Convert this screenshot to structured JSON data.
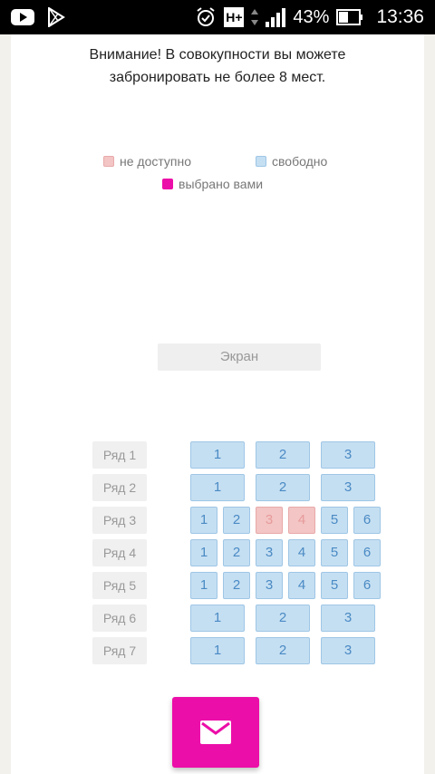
{
  "status_bar": {
    "battery_percent": "43%",
    "time": "13:36",
    "network": "H+"
  },
  "notice": {
    "line1": "Внимание! В совокупности вы можете",
    "line2": "забронировать не более 8 мест."
  },
  "legend": {
    "unavailable": "не доступно",
    "available": "свободно",
    "selected": "выбрано вами"
  },
  "colors": {
    "unavailable": "#f3c5c5",
    "available": "#c5dff2",
    "selected": "#ec0ea8"
  },
  "screen_label": "Экран",
  "rows": [
    {
      "label": "Ряд 1",
      "seats": [
        {
          "n": "1",
          "status": "available"
        },
        {
          "n": "2",
          "status": "available"
        },
        {
          "n": "3",
          "status": "available"
        }
      ]
    },
    {
      "label": "Ряд 2",
      "seats": [
        {
          "n": "1",
          "status": "available"
        },
        {
          "n": "2",
          "status": "available"
        },
        {
          "n": "3",
          "status": "available"
        }
      ]
    },
    {
      "label": "Ряд 3",
      "seats": [
        {
          "n": "1",
          "status": "available"
        },
        {
          "n": "2",
          "status": "available"
        },
        {
          "n": "3",
          "status": "unavailable"
        },
        {
          "n": "4",
          "status": "unavailable"
        },
        {
          "n": "5",
          "status": "available"
        },
        {
          "n": "6",
          "status": "available"
        }
      ]
    },
    {
      "label": "Ряд 4",
      "seats": [
        {
          "n": "1",
          "status": "available"
        },
        {
          "n": "2",
          "status": "available"
        },
        {
          "n": "3",
          "status": "available"
        },
        {
          "n": "4",
          "status": "available"
        },
        {
          "n": "5",
          "status": "available"
        },
        {
          "n": "6",
          "status": "available"
        }
      ]
    },
    {
      "label": "Ряд 5",
      "seats": [
        {
          "n": "1",
          "status": "available"
        },
        {
          "n": "2",
          "status": "available"
        },
        {
          "n": "3",
          "status": "available"
        },
        {
          "n": "4",
          "status": "available"
        },
        {
          "n": "5",
          "status": "available"
        },
        {
          "n": "6",
          "status": "available"
        }
      ]
    },
    {
      "label": "Ряд 6",
      "seats": [
        {
          "n": "1",
          "status": "available"
        },
        {
          "n": "2",
          "status": "available"
        },
        {
          "n": "3",
          "status": "available"
        }
      ]
    },
    {
      "label": "Ряд 7",
      "seats": [
        {
          "n": "1",
          "status": "available"
        },
        {
          "n": "2",
          "status": "available"
        },
        {
          "n": "3",
          "status": "available"
        }
      ]
    }
  ],
  "send_button_icon": "envelope-icon"
}
